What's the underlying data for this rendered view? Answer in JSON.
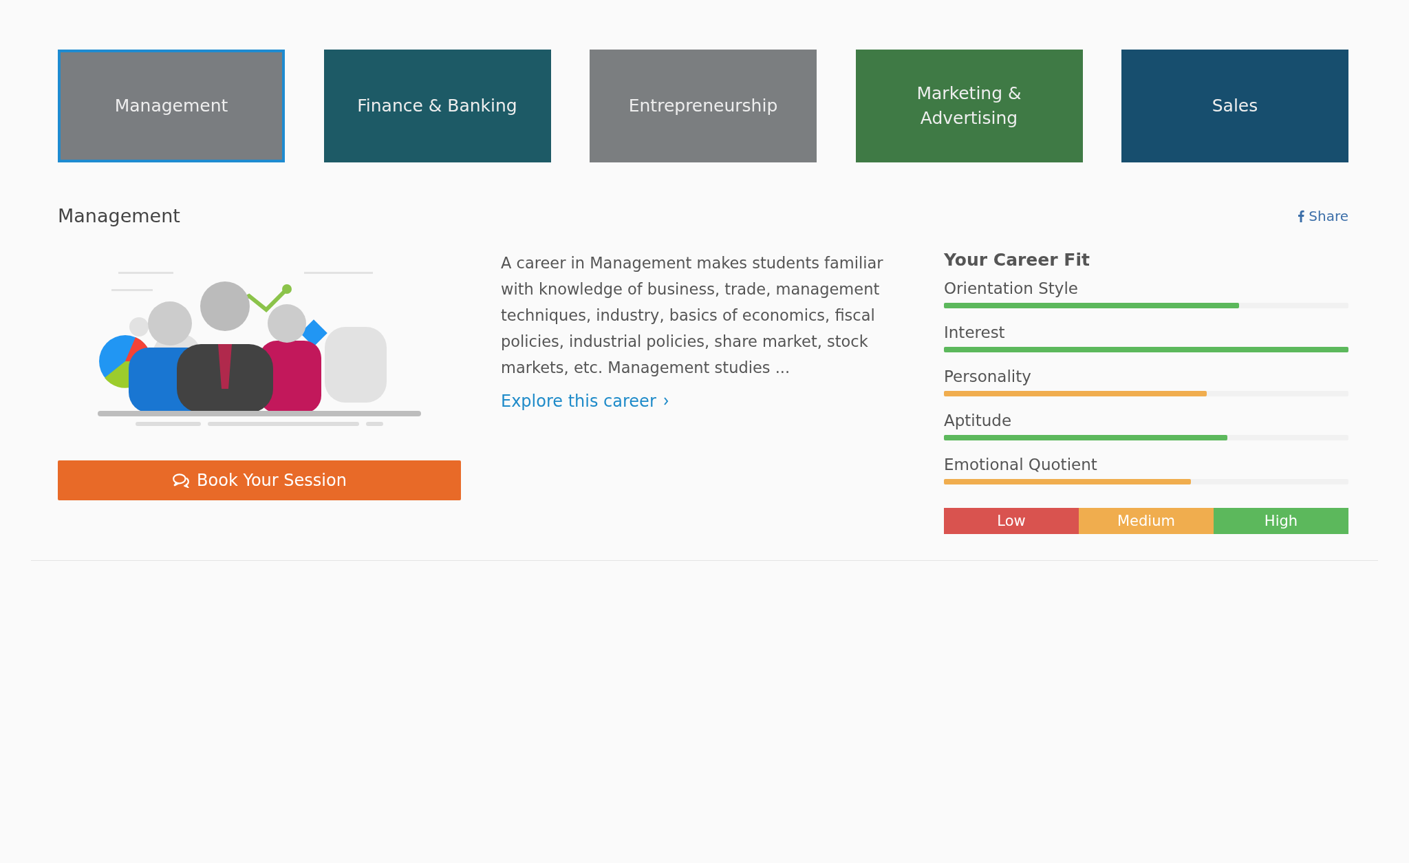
{
  "careers": [
    {
      "label": "Management",
      "selected": true,
      "color": "#7a7d80"
    },
    {
      "label": "Finance & Banking",
      "selected": false,
      "color": "#1d5a66"
    },
    {
      "label": "Entrepreneurship",
      "selected": false,
      "color": "#7b7e80"
    },
    {
      "label": "Marketing &\nAdvertising",
      "selected": false,
      "color": "#3f7a45"
    },
    {
      "label": "Sales",
      "selected": false,
      "color": "#174e6e"
    }
  ],
  "detail": {
    "title": "Management",
    "share": "Share",
    "description": "A career in Management makes students familiar with knowledge of business, trade, management techniques, industry, basics of economics, fiscal policies, industrial policies, share market, stock markets, etc. Management studies ...",
    "explore": "Explore this career",
    "book_button": "Book Your Session"
  },
  "career_fit": {
    "title": "Your Career Fit",
    "traits": [
      {
        "name": "Orientation Style",
        "level": 0.73,
        "color": "#5cb85c"
      },
      {
        "name": "Interest",
        "level": 1.0,
        "color": "#5cb85c"
      },
      {
        "name": "Personality",
        "level": 0.65,
        "color": "#f0ad4e"
      },
      {
        "name": "Aptitude",
        "level": 0.7,
        "color": "#5cb85c"
      },
      {
        "name": "Emotional Quotient",
        "level": 0.61,
        "color": "#f0ad4e"
      }
    ],
    "legend": [
      {
        "label": "Low",
        "color": "#d9534f"
      },
      {
        "label": "Medium",
        "color": "#f0ad4e"
      },
      {
        "label": "High",
        "color": "#5cb85c"
      }
    ]
  }
}
